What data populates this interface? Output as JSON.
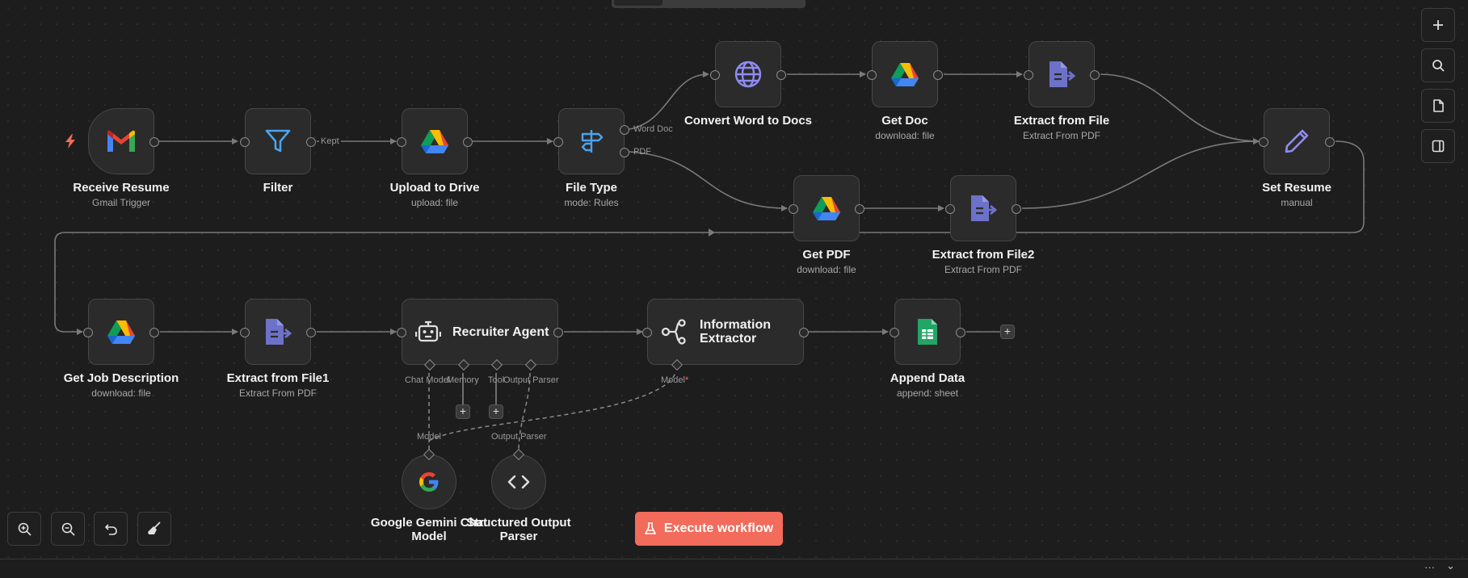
{
  "canvas": {
    "nodes": {
      "receive_resume": {
        "title": "Receive Resume",
        "subtitle": "Gmail Trigger",
        "icon": "gmail-icon"
      },
      "filter": {
        "title": "Filter",
        "subtitle": "",
        "icon": "funnel-icon"
      },
      "upload_drive": {
        "title": "Upload to Drive",
        "subtitle": "upload: file",
        "icon": "google-drive-icon"
      },
      "file_type": {
        "title": "File Type",
        "subtitle": "mode: Rules",
        "icon": "signpost-icon"
      },
      "convert_word": {
        "title": "Convert Word to Docs",
        "subtitle": "",
        "icon": "globe-icon"
      },
      "get_doc": {
        "title": "Get Doc",
        "subtitle": "download: file",
        "icon": "google-drive-icon"
      },
      "extract_file": {
        "title": "Extract from File",
        "subtitle": "Extract From PDF",
        "icon": "file-extract-icon"
      },
      "set_resume": {
        "title": "Set Resume",
        "subtitle": "manual",
        "icon": "pencil-icon"
      },
      "get_pdf": {
        "title": "Get PDF",
        "subtitle": "download: file",
        "icon": "google-drive-icon"
      },
      "extract_file2": {
        "title": "Extract from File2",
        "subtitle": "Extract From PDF",
        "icon": "file-extract-icon"
      },
      "get_job": {
        "title": "Get Job Description",
        "subtitle": "download: file",
        "icon": "google-drive-icon"
      },
      "extract_file1": {
        "title": "Extract from File1",
        "subtitle": "Extract From PDF",
        "icon": "file-extract-icon"
      },
      "recruiter_agent": {
        "title": "Recruiter Agent",
        "icon": "robot-icon"
      },
      "info_extractor": {
        "title_line1": "Information",
        "title_line2": "Extractor",
        "icon": "nodes-icon"
      },
      "append_data": {
        "title": "Append Data",
        "subtitle": "append: sheet",
        "icon": "google-sheets-icon"
      },
      "gemini": {
        "title_line1": "Google Gemini Chat",
        "title_line2": "Model",
        "icon": "google-icon"
      },
      "structured_parser": {
        "title_line1": "Structured Output",
        "title_line2": "Parser",
        "icon": "code-brackets-icon"
      }
    },
    "edge_labels": {
      "kept": "Kept",
      "word_doc": "Word Doc",
      "pdf": "PDF",
      "chat_model": "Chat Model",
      "memory": "Memory",
      "tool": "Tool",
      "output_parser": "Output Parser",
      "model": "Model",
      "model_required": "*",
      "model_target": "Model",
      "output_parser_target": "Output Parser"
    },
    "plus": "+"
  },
  "right_toolbar": [
    {
      "name": "add-node-button",
      "icon": "plus-icon"
    },
    {
      "name": "search-button",
      "icon": "search-icon"
    },
    {
      "name": "sticky-note-button",
      "icon": "note-icon"
    },
    {
      "name": "panel-toggle-button",
      "icon": "panel-icon"
    }
  ],
  "bottom_toolbar": {
    "zoom_in": "zoom-in-icon",
    "zoom_out": "zoom-out-icon",
    "reset": "undo-icon",
    "tidy": "broom-icon"
  },
  "execute_button": {
    "label": "Execute workflow",
    "icon": "flask-icon"
  },
  "bottom_bar": {
    "dots": "···",
    "chevron": "⌄"
  },
  "colors": {
    "accent": "#f26b5b",
    "node_bg": "#2b2b2b",
    "edge": "#7a7a7a",
    "trigger_bolt": "#f26b5b"
  }
}
